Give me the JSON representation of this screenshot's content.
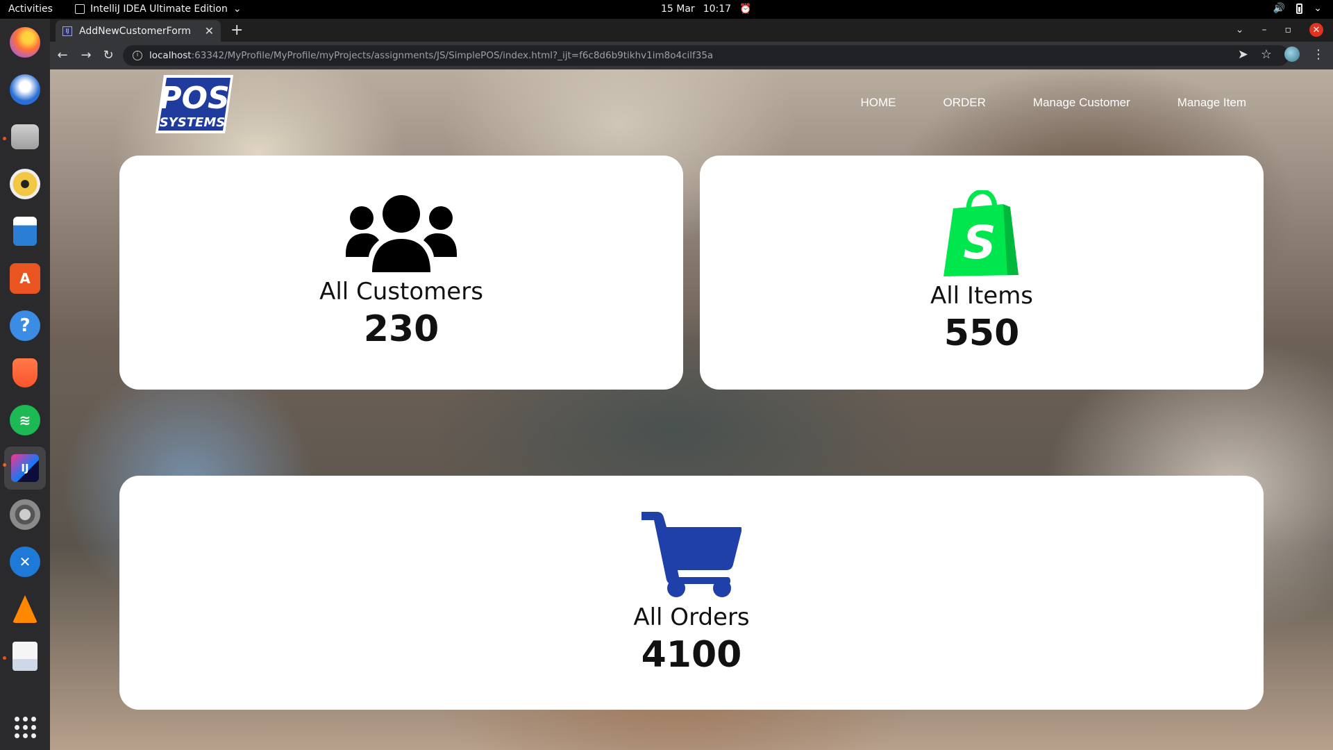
{
  "system": {
    "activities_label": "Activities",
    "app_name": "IntelliJ IDEA Ultimate Edition",
    "date": "15 Mar",
    "time": "10:17"
  },
  "dock": {
    "items": [
      {
        "name": "firefox-icon",
        "color": "#ff7139"
      },
      {
        "name": "thunderbird-icon",
        "color": "#2a6fd6"
      },
      {
        "name": "files-icon",
        "color": "#d9d9d9"
      },
      {
        "name": "rhythmbox-icon",
        "color": "#f2c744"
      },
      {
        "name": "libreoffice-writer-icon",
        "color": "#2a7fd4"
      },
      {
        "name": "app-center-icon",
        "color": "#e95420"
      },
      {
        "name": "help-icon",
        "color": "#3b8de4"
      },
      {
        "name": "brave-icon",
        "color": "#fb542b"
      },
      {
        "name": "spotify-icon",
        "color": "#1db954"
      },
      {
        "name": "intellij-icon",
        "color": "#0d0d3c"
      },
      {
        "name": "settings-icon",
        "color": "#8a8a8a"
      },
      {
        "name": "compass-icon",
        "color": "#1e7ad6"
      },
      {
        "name": "vlc-icon",
        "color": "#ff8800"
      },
      {
        "name": "document-viewer-icon",
        "color": "#f5f5f5"
      }
    ]
  },
  "browser": {
    "tab_title": "AddNewCustomerForm",
    "url_host": "localhost",
    "url_rest": ":63342/MyProfile/MyProfile/myProjects/assignments/JS/SimplePOS/index.html?_ijt=f6c8d6b9tikhv1im8o4cilf35a"
  },
  "navbar": {
    "logo_line1": "POS",
    "logo_line2": "SYSTEMS",
    "links": [
      "HOME",
      "ORDER",
      "Manage Customer",
      "Manage Item"
    ]
  },
  "cards": {
    "customers": {
      "title": "All Customers",
      "count": "230",
      "icon": "users-icon",
      "icon_color": "#000000"
    },
    "items": {
      "title": "All Items",
      "count": "550",
      "icon": "shopping-bag-icon",
      "icon_color": "#00e64d"
    },
    "orders": {
      "title": "All Orders",
      "count": "4100",
      "icon": "cart-icon",
      "icon_color": "#1f3fa9"
    }
  }
}
